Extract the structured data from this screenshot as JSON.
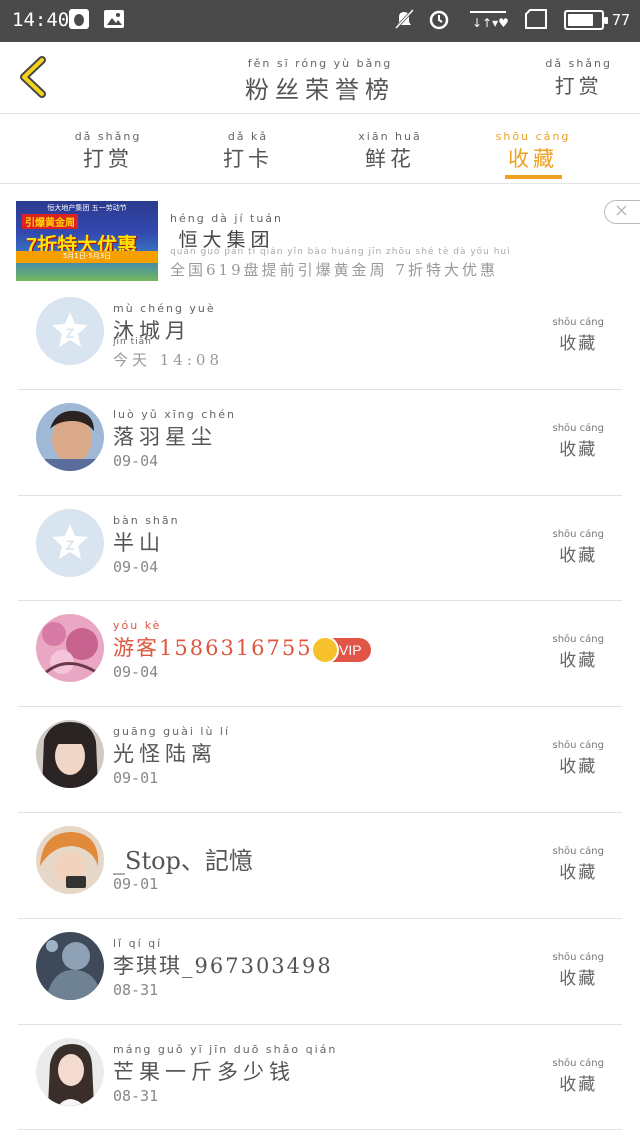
{
  "status_bar": {
    "time": "14:40",
    "battery_level": "77",
    "battery_fraction": 0.77,
    "left_icons": [
      "qq-penguin-icon",
      "image-icon"
    ],
    "right_icons": [
      "mute-icon",
      "alarm-icon",
      "signal-icon",
      "sim-icon",
      "battery-icon"
    ]
  },
  "header": {
    "title_pinyin": "fěn  sī  róng  yù  bǎng",
    "title": "粉丝荣誉榜",
    "right_pinyin": "dǎ shǎng",
    "right_label": "打赏",
    "back_icon": "chevron-left-icon",
    "accent": "#f0a020"
  },
  "tabs": [
    {
      "pinyin": "dǎ  shǎng",
      "label": "打赏",
      "active": false
    },
    {
      "pinyin": "dǎ   kǎ",
      "label": "打卡",
      "active": false
    },
    {
      "pinyin": "xiān  huā",
      "label": "鲜花",
      "active": false
    },
    {
      "pinyin": "shōu cáng",
      "label": "收藏",
      "active": true
    }
  ],
  "ad": {
    "image_top_text": "恒大地产集团 五一劳动节",
    "image_mid_text": "引爆黄金周",
    "image_big_text": "7折特大优惠",
    "image_bottom_text": "5月1日-5月3日",
    "name_pinyin": "héng  dà   jí   tuán",
    "name": "恒大集团",
    "desc_pinyin": "quán guó        pán  tí  qián yǐn  bào huáng jīn zhōu      shé   tè   dà  yōu huì",
    "desc": "全国619盘提前引爆黄金周 7折特大优惠",
    "close_icon": "close-icon"
  },
  "fav_label": {
    "pinyin": "shōu cáng",
    "label": "收藏"
  },
  "users": [
    {
      "name_pinyin": "mù chéng yuè",
      "name": "沐城月",
      "date_pinyin": "jīn  tiān",
      "date": "今天 14:08",
      "avatar": "default-avatar",
      "vip": false
    },
    {
      "name_pinyin": "luò  yǔ  xīng chén",
      "name": "落羽星尘",
      "date": "09-04",
      "avatar": "photo-boy",
      "vip": false
    },
    {
      "name_pinyin": "bàn  shān",
      "name": "半山",
      "date": "09-04",
      "avatar": "default-avatar",
      "vip": false
    },
    {
      "name_pinyin": "yóu  kè",
      "name": "游客1586316755066",
      "date": "09-04",
      "avatar": "photo-blossom",
      "vip": true,
      "vip_label": "VIP"
    },
    {
      "name_pinyin": "guāng guài  lù   lí",
      "name": "光怪陆离",
      "date": "09-01",
      "avatar": "photo-girl",
      "vip": false
    },
    {
      "name_pinyin": "",
      "name": "_Stop、記憶",
      "date": "09-01",
      "avatar": "photo-redhair",
      "vip": false
    },
    {
      "name_pinyin": "lǐ    qí    qí",
      "name": "李琪琪_967303498",
      "date": "08-31",
      "avatar": "photo-dark",
      "vip": false
    },
    {
      "name_pinyin": "máng guǒ  yī   jīn  duō shǎo qián",
      "name": "芒果一斤多少钱",
      "date": "08-31",
      "avatar": "photo-longhair",
      "vip": false
    }
  ]
}
